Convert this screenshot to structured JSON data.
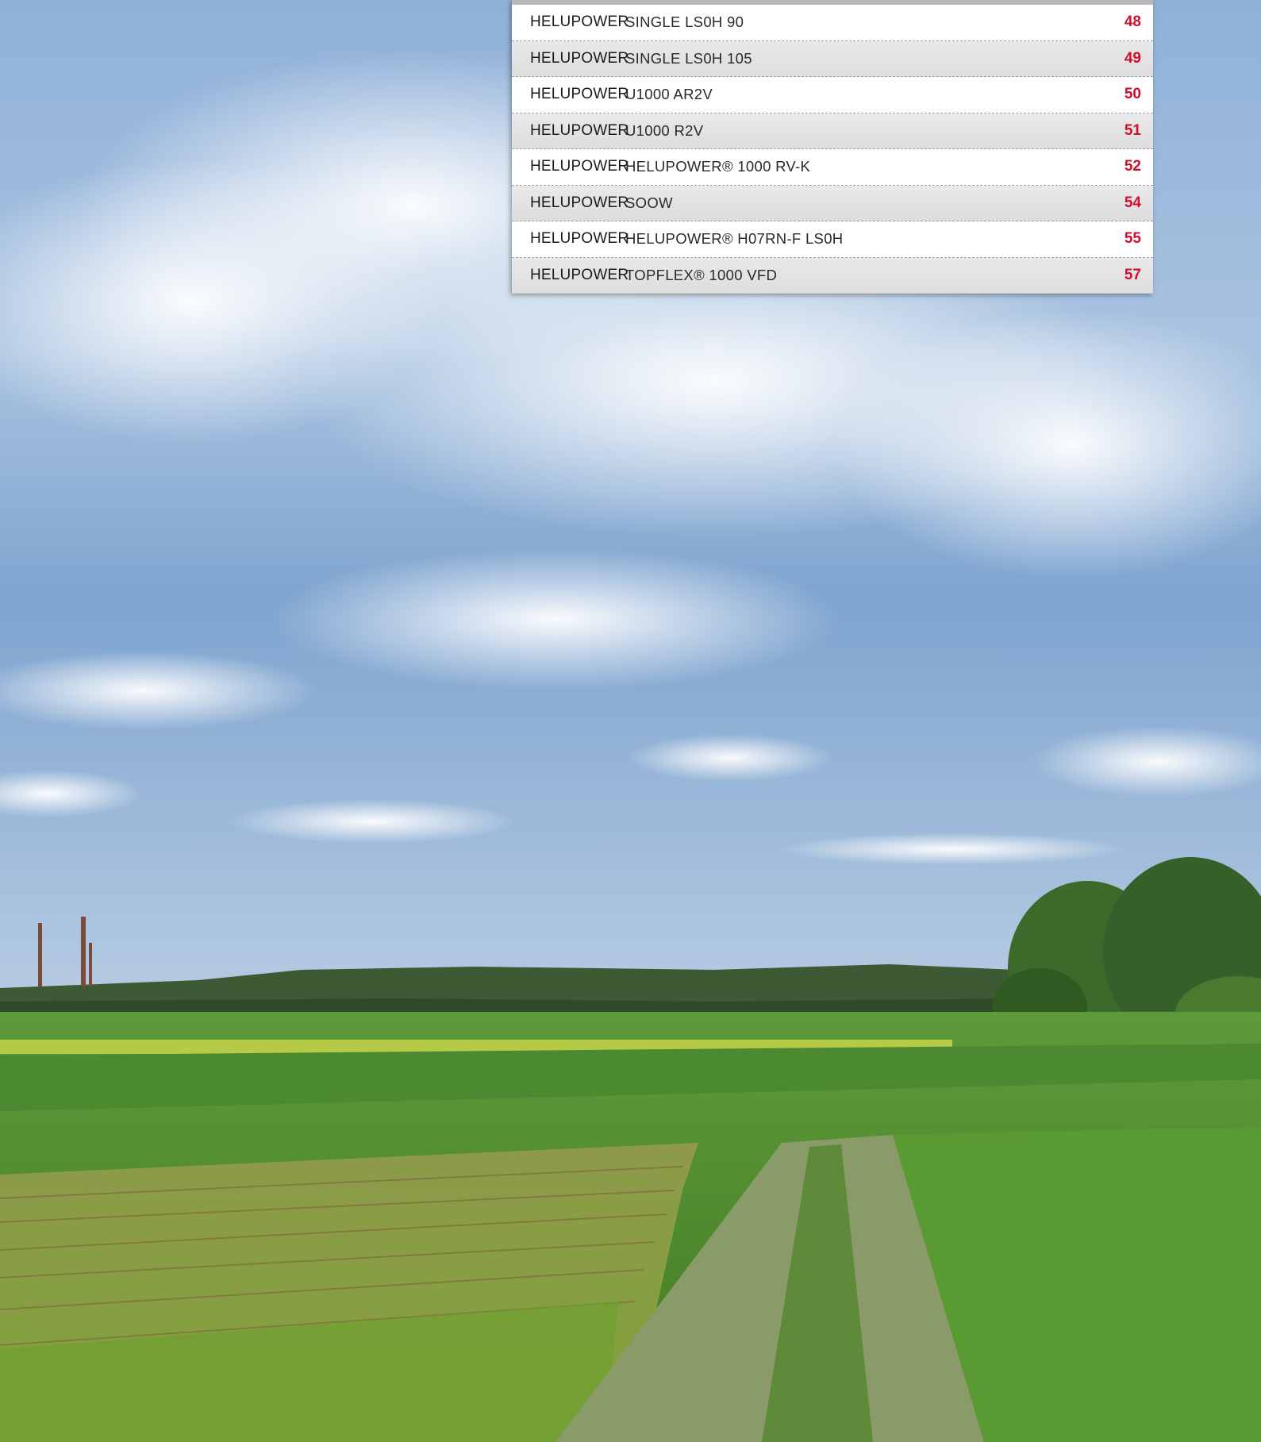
{
  "toc": {
    "rows": [
      {
        "brand": "HELUPOWER",
        "product": "SINGLE LS0H 90",
        "page": "48"
      },
      {
        "brand": "HELUPOWER",
        "product": "SINGLE LS0H 105",
        "page": "49"
      },
      {
        "brand": "HELUPOWER",
        "product": "U1000 AR2V",
        "page": "50"
      },
      {
        "brand": "HELUPOWER",
        "product": "U1000 R2V",
        "page": "51"
      },
      {
        "brand": "HELUPOWER",
        "product": "HELUPOWER® 1000  RV-K",
        "page": "52"
      },
      {
        "brand": "HELUPOWER",
        "product": "SOOW",
        "page": "54"
      },
      {
        "brand": "HELUPOWER",
        "product": "HELUPOWER® H07RN-F LS0H",
        "page": "55"
      },
      {
        "brand": "HELUPOWER",
        "product": "TOPFLEX® 1000 VFD",
        "page": "57"
      }
    ]
  },
  "colors": {
    "accent_red": "#d0102b",
    "sky_top": "#6f97c9",
    "field_green": "#4f8a2a"
  }
}
